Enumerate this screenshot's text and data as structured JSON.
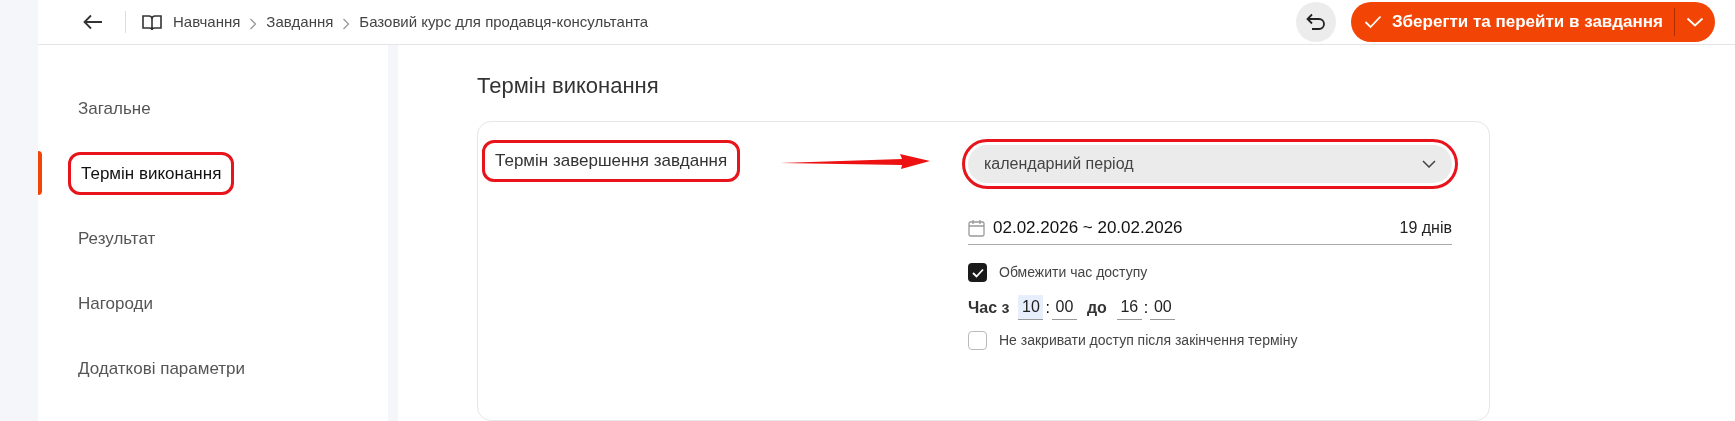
{
  "breadcrumbs": [
    "Навчання",
    "Завдання",
    "Базовий курс для продавця-консультанта"
  ],
  "save_button": {
    "label": "Зберегти та перейти в завдання"
  },
  "sidebar": {
    "items": [
      {
        "label": "Загальне",
        "selected": false,
        "highlighted": false
      },
      {
        "label": "Термін виконання",
        "selected": true,
        "highlighted": true
      },
      {
        "label": "Результат",
        "selected": false,
        "highlighted": false
      },
      {
        "label": "Нагороди",
        "selected": false,
        "highlighted": false
      },
      {
        "label": "Додаткові параметри",
        "selected": false,
        "highlighted": false
      }
    ]
  },
  "section": {
    "title": "Термін виконання",
    "field_label": {
      "text": "Термін завершення завдання",
      "highlighted": true
    },
    "select": {
      "value": "календарний період",
      "highlighted": true
    },
    "date_range": {
      "value": "02.02.2026 ~ 20.02.2026",
      "duration": "19 днів"
    },
    "limit_time": {
      "label": "Обмежити час доступу",
      "checked": true
    },
    "time": {
      "from_label": "Час з",
      "to_label": "до",
      "separator": ":",
      "fields": [
        {
          "value": "10",
          "selected": true
        },
        {
          "value": "00",
          "selected": false
        },
        {
          "value": "16",
          "selected": false
        },
        {
          "value": "00",
          "selected": false
        }
      ]
    },
    "keep_access": {
      "label": "Не закривати доступ після закінчення терміну",
      "checked": false
    }
  }
}
